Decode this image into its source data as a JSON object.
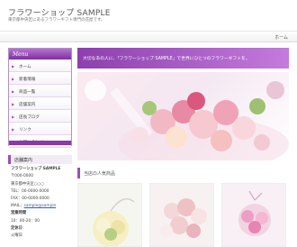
{
  "header": {
    "title": "フラワーショップ SAMPLE",
    "description": "東京都中央区にあるフラワーギフト専門の花屋です。"
  },
  "topnav": {
    "link_label": "ホーム"
  },
  "sidebar": {
    "menu_title": "Menu",
    "items": [
      {
        "label": "ホーム"
      },
      {
        "label": "新着情報"
      },
      {
        "label": "商品一覧"
      },
      {
        "label": "店舗案内"
      },
      {
        "label": "店長ブログ"
      },
      {
        "label": "リンク"
      },
      {
        "label": "お問い合わせ"
      }
    ],
    "info": {
      "heading": "店舗案内",
      "shop_name": "フラワーショップ SAMPLE",
      "postal": "〒000-0000",
      "address": "東京都中央区○○○",
      "tel": "TEL：00-0000-0000",
      "fax": "FAX：00-0000-0000",
      "mail_label": "MAIL：",
      "mail": "sample@sample",
      "hours_heading": "営業時間",
      "hours": "10：00-20：00",
      "closed_heading": "定休日",
      "closed": "火曜日"
    }
  },
  "banner": {
    "text": "大切なあの人に、「フラワーショップ SAMPLE」で世界にひとつのフラワーギフトを。"
  },
  "section": {
    "title": "当店の人気商品"
  },
  "colors": {
    "accent": "#8c3fad",
    "accent_light": "#c47bdc"
  }
}
